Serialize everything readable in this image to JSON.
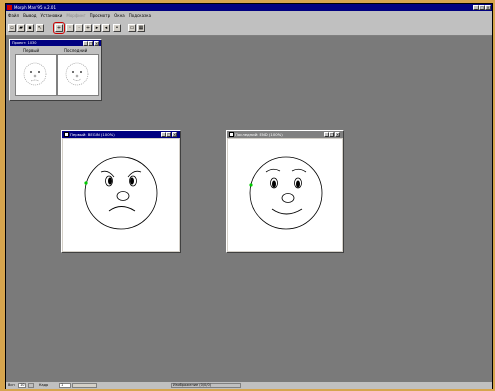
{
  "app": {
    "title": "Morph Man'95 v.2.01"
  },
  "menu": {
    "items": [
      "Файл",
      "Вывод",
      "Установки",
      "Морфинг",
      "Просмотр",
      "Окна",
      "Подсказка"
    ],
    "disabled": [
      false,
      false,
      false,
      true,
      false,
      false,
      false
    ]
  },
  "toolbar": {
    "buttons": [
      "new-icon",
      "open-icon",
      "save-icon",
      "add-point-icon",
      "select-icon",
      "delete-icon",
      "zoom-icon",
      "play-icon",
      "stop-icon",
      "options-icon",
      "fit-icon",
      "grid-icon"
    ],
    "highlighted_index": 3
  },
  "thumbnails": {
    "title": "Проект: 1030",
    "first_label": "Первый",
    "last_label": "Последний"
  },
  "windows": {
    "first": {
      "title": "Первый: BEGIN (100%)",
      "expression": "angry"
    },
    "last": {
      "title": "Последний: END (100%)",
      "expression": "smile"
    }
  },
  "status": {
    "frames_label": "Всп",
    "frames_value": "10",
    "frame_label": "Кадр",
    "frame_value": "1",
    "image_info": "Изображение (0/0/0)"
  },
  "colors": {
    "desktop": "#d6a54e",
    "workspace": "#7a7a7a",
    "titlebar_active": "#000080",
    "titlebar_inactive": "#808080",
    "highlight_ring": "#cc0000",
    "control_point": "#00cc00"
  }
}
